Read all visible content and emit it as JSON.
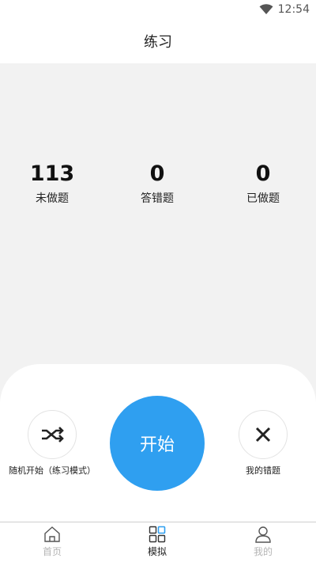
{
  "status_bar": {
    "time": "12:54"
  },
  "header": {
    "title": "练习"
  },
  "stats": [
    {
      "value": "113",
      "label": "未做题"
    },
    {
      "value": "0",
      "label": "答错题"
    },
    {
      "value": "0",
      "label": "已做题"
    }
  ],
  "actions": {
    "random_label": "随机开始（练习模式）",
    "start_label": "开始",
    "wrong_label": "我的错题"
  },
  "tabs": [
    {
      "label": "首页",
      "icon": "home-icon",
      "active": false
    },
    {
      "label": "模拟",
      "icon": "grid-icon",
      "active": true
    },
    {
      "label": "我的",
      "icon": "user-icon",
      "active": false
    }
  ],
  "colors": {
    "accent": "#2f9ff0",
    "background": "#f2f2f2",
    "tab_inactive": "#b5b5b5"
  }
}
